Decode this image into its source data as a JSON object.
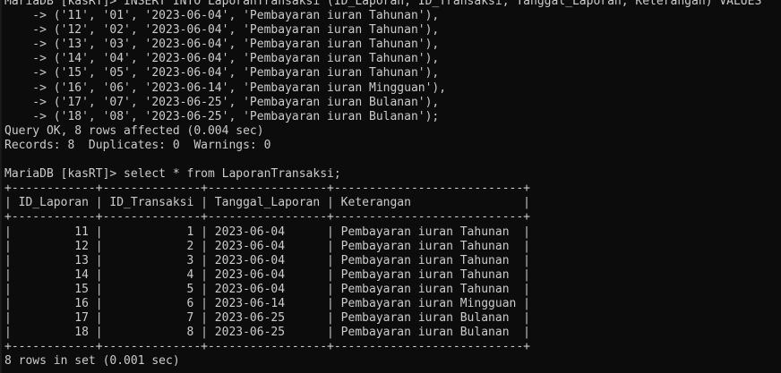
{
  "terminal": {
    "lines": [
      "MariaDB [kasRT]> INSERT INTO LaporanTransaksi (ID_Laporan, ID_Transaksi, Tanggal_Laporan, Keterangan) VALUES",
      "    -> ('11', '01', '2023-06-04', 'Pembayaran iuran Tahunan'),",
      "    -> ('12', '02', '2023-06-04', 'Pembayaran iuran Tahunan'),",
      "    -> ('13', '03', '2023-06-04', 'Pembayaran iuran Tahunan'),",
      "    -> ('14', '04', '2023-06-04', 'Pembayaran iuran Tahunan'),",
      "    -> ('15', '05', '2023-06-04', 'Pembayaran iuran Tahunan'),",
      "    -> ('16', '06', '2023-06-14', 'Pembayaran iuran Mingguan'),",
      "    -> ('17', '07', '2023-06-25', 'Pembayaran iuran Bulanan'),",
      "    -> ('18', '08', '2023-06-25', 'Pembayaran iuran Bulanan');",
      "Query OK, 8 rows affected (0.004 sec)",
      "Records: 8  Duplicates: 0  Warnings: 0",
      "",
      "MariaDB [kasRT]> select * from LaporanTransaksi;",
      "+------------+--------------+-----------------+---------------------------+",
      "| ID_Laporan | ID_Transaksi | Tanggal_Laporan | Keterangan                |",
      "+------------+--------------+-----------------+---------------------------+",
      "|         11 |            1 | 2023-06-04      | Pembayaran iuran Tahunan  |",
      "|         12 |            2 | 2023-06-04      | Pembayaran iuran Tahunan  |",
      "|         13 |            3 | 2023-06-04      | Pembayaran iuran Tahunan  |",
      "|         14 |            4 | 2023-06-04      | Pembayaran iuran Tahunan  |",
      "|         15 |            5 | 2023-06-04      | Pembayaran iuran Tahunan  |",
      "|         16 |            6 | 2023-06-14      | Pembayaran iuran Mingguan |",
      "|         17 |            7 | 2023-06-25      | Pembayaran iuran Bulanan  |",
      "|         18 |            8 | 2023-06-25      | Pembayaran iuran Bulanan  |",
      "+------------+--------------+-----------------+---------------------------+",
      "8 rows in set (0.001 sec)"
    ]
  }
}
